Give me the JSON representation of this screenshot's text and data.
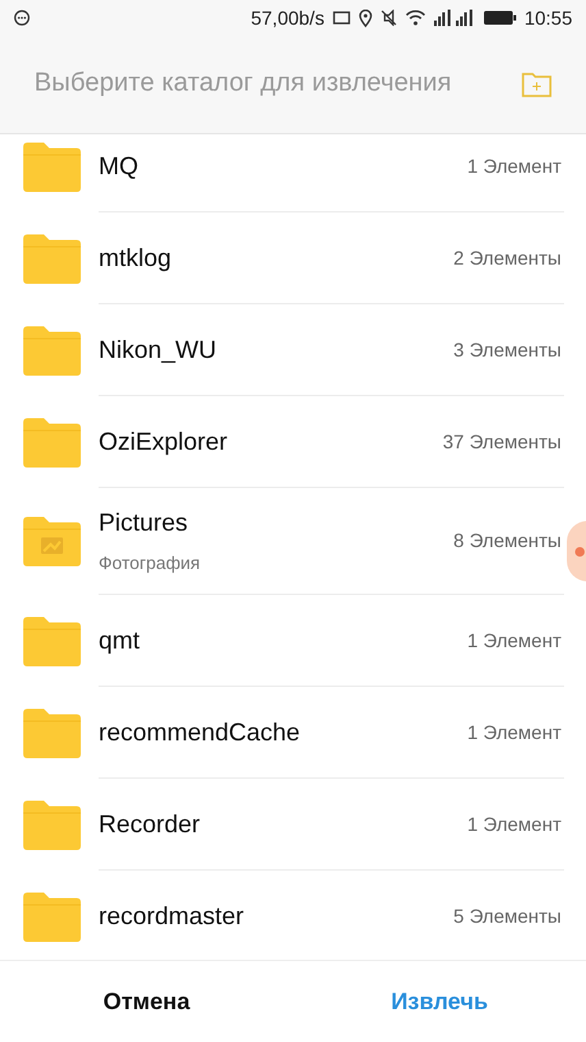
{
  "status_bar": {
    "speed": "57,00b/s",
    "time": "10:55"
  },
  "header": {
    "title": "Выберите каталог для извлечения"
  },
  "folders": [
    {
      "name": "MQ",
      "count": "1 Элемент",
      "kind": "folder"
    },
    {
      "name": "mtklog",
      "count": "2 Элементы",
      "kind": "folder"
    },
    {
      "name": "Nikon_WU",
      "count": "3 Элементы",
      "kind": "folder"
    },
    {
      "name": "OziExplorer",
      "count": "37 Элементы",
      "kind": "folder"
    },
    {
      "name": "Pictures",
      "subtitle": "Фотография",
      "count": "8 Элементы",
      "kind": "pictures"
    },
    {
      "name": "qmt",
      "count": "1 Элемент",
      "kind": "folder"
    },
    {
      "name": "recommendCache",
      "count": "1 Элемент",
      "kind": "folder"
    },
    {
      "name": "Recorder",
      "count": "1 Элемент",
      "kind": "folder"
    },
    {
      "name": "recordmaster",
      "count": "5 Элементы",
      "kind": "folder"
    }
  ],
  "buttons": [
    {
      "label": "Отмена",
      "kind": "cancel"
    },
    {
      "label": "Извлечь",
      "kind": "primary"
    }
  ]
}
